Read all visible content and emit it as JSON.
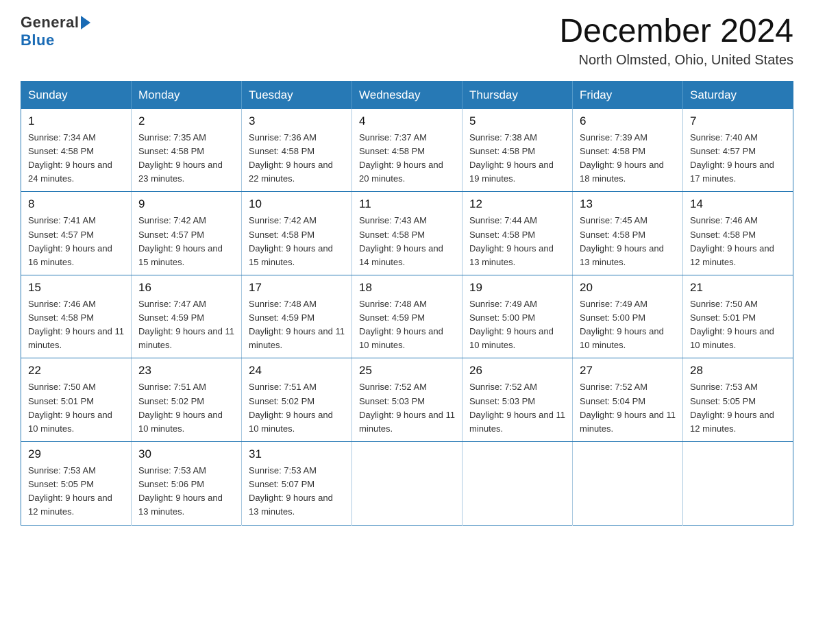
{
  "logo": {
    "general": "General",
    "blue": "Blue"
  },
  "title": "December 2024",
  "location": "North Olmsted, Ohio, United States",
  "headers": [
    "Sunday",
    "Monday",
    "Tuesday",
    "Wednesday",
    "Thursday",
    "Friday",
    "Saturday"
  ],
  "weeks": [
    [
      {
        "day": "1",
        "sunrise": "7:34 AM",
        "sunset": "4:58 PM",
        "daylight": "9 hours and 24 minutes."
      },
      {
        "day": "2",
        "sunrise": "7:35 AM",
        "sunset": "4:58 PM",
        "daylight": "9 hours and 23 minutes."
      },
      {
        "day": "3",
        "sunrise": "7:36 AM",
        "sunset": "4:58 PM",
        "daylight": "9 hours and 22 minutes."
      },
      {
        "day": "4",
        "sunrise": "7:37 AM",
        "sunset": "4:58 PM",
        "daylight": "9 hours and 20 minutes."
      },
      {
        "day": "5",
        "sunrise": "7:38 AM",
        "sunset": "4:58 PM",
        "daylight": "9 hours and 19 minutes."
      },
      {
        "day": "6",
        "sunrise": "7:39 AM",
        "sunset": "4:58 PM",
        "daylight": "9 hours and 18 minutes."
      },
      {
        "day": "7",
        "sunrise": "7:40 AM",
        "sunset": "4:57 PM",
        "daylight": "9 hours and 17 minutes."
      }
    ],
    [
      {
        "day": "8",
        "sunrise": "7:41 AM",
        "sunset": "4:57 PM",
        "daylight": "9 hours and 16 minutes."
      },
      {
        "day": "9",
        "sunrise": "7:42 AM",
        "sunset": "4:57 PM",
        "daylight": "9 hours and 15 minutes."
      },
      {
        "day": "10",
        "sunrise": "7:42 AM",
        "sunset": "4:58 PM",
        "daylight": "9 hours and 15 minutes."
      },
      {
        "day": "11",
        "sunrise": "7:43 AM",
        "sunset": "4:58 PM",
        "daylight": "9 hours and 14 minutes."
      },
      {
        "day": "12",
        "sunrise": "7:44 AM",
        "sunset": "4:58 PM",
        "daylight": "9 hours and 13 minutes."
      },
      {
        "day": "13",
        "sunrise": "7:45 AM",
        "sunset": "4:58 PM",
        "daylight": "9 hours and 13 minutes."
      },
      {
        "day": "14",
        "sunrise": "7:46 AM",
        "sunset": "4:58 PM",
        "daylight": "9 hours and 12 minutes."
      }
    ],
    [
      {
        "day": "15",
        "sunrise": "7:46 AM",
        "sunset": "4:58 PM",
        "daylight": "9 hours and 11 minutes."
      },
      {
        "day": "16",
        "sunrise": "7:47 AM",
        "sunset": "4:59 PM",
        "daylight": "9 hours and 11 minutes."
      },
      {
        "day": "17",
        "sunrise": "7:48 AM",
        "sunset": "4:59 PM",
        "daylight": "9 hours and 11 minutes."
      },
      {
        "day": "18",
        "sunrise": "7:48 AM",
        "sunset": "4:59 PM",
        "daylight": "9 hours and 10 minutes."
      },
      {
        "day": "19",
        "sunrise": "7:49 AM",
        "sunset": "5:00 PM",
        "daylight": "9 hours and 10 minutes."
      },
      {
        "day": "20",
        "sunrise": "7:49 AM",
        "sunset": "5:00 PM",
        "daylight": "9 hours and 10 minutes."
      },
      {
        "day": "21",
        "sunrise": "7:50 AM",
        "sunset": "5:01 PM",
        "daylight": "9 hours and 10 minutes."
      }
    ],
    [
      {
        "day": "22",
        "sunrise": "7:50 AM",
        "sunset": "5:01 PM",
        "daylight": "9 hours and 10 minutes."
      },
      {
        "day": "23",
        "sunrise": "7:51 AM",
        "sunset": "5:02 PM",
        "daylight": "9 hours and 10 minutes."
      },
      {
        "day": "24",
        "sunrise": "7:51 AM",
        "sunset": "5:02 PM",
        "daylight": "9 hours and 10 minutes."
      },
      {
        "day": "25",
        "sunrise": "7:52 AM",
        "sunset": "5:03 PM",
        "daylight": "9 hours and 11 minutes."
      },
      {
        "day": "26",
        "sunrise": "7:52 AM",
        "sunset": "5:03 PM",
        "daylight": "9 hours and 11 minutes."
      },
      {
        "day": "27",
        "sunrise": "7:52 AM",
        "sunset": "5:04 PM",
        "daylight": "9 hours and 11 minutes."
      },
      {
        "day": "28",
        "sunrise": "7:53 AM",
        "sunset": "5:05 PM",
        "daylight": "9 hours and 12 minutes."
      }
    ],
    [
      {
        "day": "29",
        "sunrise": "7:53 AM",
        "sunset": "5:05 PM",
        "daylight": "9 hours and 12 minutes."
      },
      {
        "day": "30",
        "sunrise": "7:53 AM",
        "sunset": "5:06 PM",
        "daylight": "9 hours and 13 minutes."
      },
      {
        "day": "31",
        "sunrise": "7:53 AM",
        "sunset": "5:07 PM",
        "daylight": "9 hours and 13 minutes."
      },
      null,
      null,
      null,
      null
    ]
  ]
}
